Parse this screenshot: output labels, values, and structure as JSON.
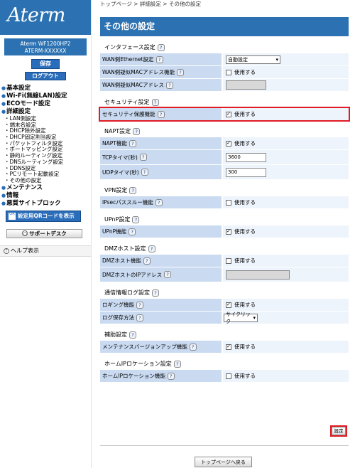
{
  "sidebar": {
    "logo": "Aterm",
    "model_line1": "Aterm  WF1200HP2",
    "model_line2": "ATERM-XXXXXX",
    "save_label": "保存",
    "logout_label": "ログアウト",
    "nav": [
      {
        "label": "基本設定",
        "type": "top"
      },
      {
        "label": "Wi-Fi(無線LAN)設定",
        "type": "top"
      },
      {
        "label": "ECOモード設定",
        "type": "top"
      },
      {
        "label": "詳細設定",
        "type": "top"
      },
      {
        "label": "LAN側設定",
        "type": "sub"
      },
      {
        "label": "端末名設定",
        "type": "sub"
      },
      {
        "label": "DHCP除外設定",
        "type": "sub"
      },
      {
        "label": "DHCP固定割当設定",
        "type": "sub"
      },
      {
        "label": "パケットフィルタ設定",
        "type": "sub"
      },
      {
        "label": "ポートマッピング設定",
        "type": "sub"
      },
      {
        "label": "静的ルーティング設定",
        "type": "sub"
      },
      {
        "label": "DNSルーティング設定",
        "type": "sub"
      },
      {
        "label": "DDNS設定",
        "type": "sub"
      },
      {
        "label": "PCリモート起動設定",
        "type": "sub"
      },
      {
        "label": "その他の設定",
        "type": "sub"
      },
      {
        "label": "メンテナンス",
        "type": "top"
      },
      {
        "label": "情報",
        "type": "top"
      },
      {
        "label": "悪質サイトブロック",
        "type": "top"
      }
    ],
    "qr_label": "設定用QRコードを表示",
    "qr_icon_text": "QR",
    "support_label": "サポートデスク",
    "help_label": "ヘルプ表示"
  },
  "breadcrumb": "トップページ > 詳細設定 > その他の設定",
  "page_title": "その他の設定",
  "sections": {
    "interface": {
      "heading": "インタフェース設定",
      "wan_eth_label": "WAN側Ethernet設定",
      "wan_eth_value": "自動設定",
      "wan_mac_enable_label": "WAN側疑似MACアドレス機能",
      "wan_mac_enable_value": "使用する",
      "wan_mac_label": "WAN側疑似MACアドレス"
    },
    "security": {
      "heading": "セキュリティ設定",
      "protect_label": "セキュリティ保護機能",
      "protect_value": "使用する"
    },
    "napt": {
      "heading": "NAPT設定",
      "napt_label": "NAPT機能",
      "napt_value": "使用する",
      "tcp_label": "TCPタイマ(秒)",
      "tcp_value": "3600",
      "udp_label": "UDPタイマ(秒)",
      "udp_value": "300"
    },
    "vpn": {
      "heading": "VPN設定",
      "ipsec_label": "IPsecパススルー機能",
      "ipsec_value": "使用する"
    },
    "upnp": {
      "heading": "UPnP設定",
      "upnp_label": "UPnP機能",
      "upnp_value": "使用する"
    },
    "dmz": {
      "heading": "DMZホスト設定",
      "dmz_label": "DMZホスト機能",
      "dmz_value": "使用する",
      "dmz_ip_label": "DMZホストのIPアドレス"
    },
    "log": {
      "heading": "通信情報ログ設定",
      "log_label": "ロギング機能",
      "log_value": "使用する",
      "save_method_label": "ログ保存方法",
      "save_method_value": "サイクリック"
    },
    "assist": {
      "heading": "補助設定",
      "maint_label": "メンテナンスバージョンアップ機能",
      "maint_value": "使用する"
    },
    "homeip": {
      "heading": "ホームIPロケーション設定",
      "homeip_label": "ホームIPロケーション機能",
      "homeip_value": "使用する"
    }
  },
  "help_glyph": "?",
  "check_glyph": "✓",
  "set_label": "設定",
  "back_label": "トップページへ戻る",
  "colors": {
    "brand": "#2c72b2",
    "label_bg": "#c9daf1",
    "value_bg": "#eef4fc",
    "highlight": "#e01b24"
  }
}
